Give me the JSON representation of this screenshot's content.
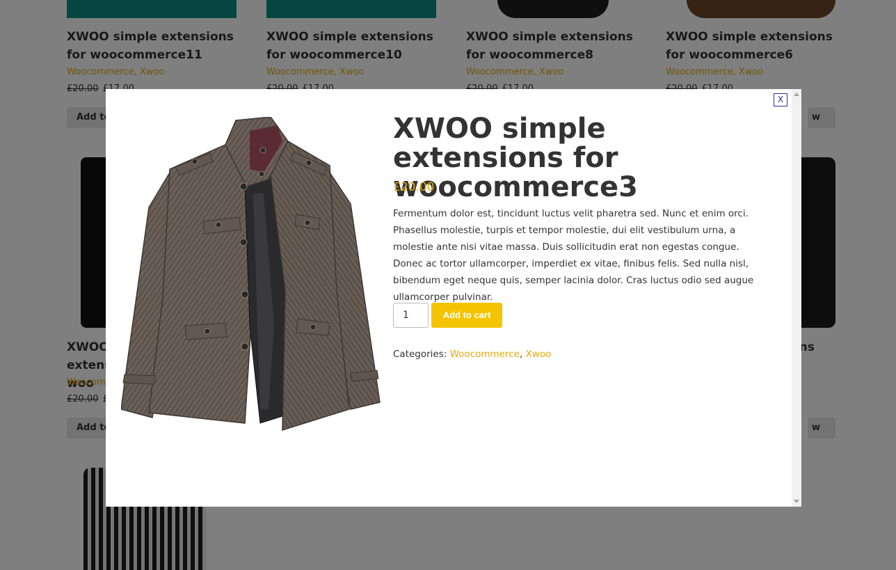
{
  "grid": {
    "cards": [
      {
        "title": "XWOO simple extensions for woocommerce11",
        "categories": "Woocommerce, Xwoo",
        "old_price": "£20.00",
        "price": "£17.00",
        "button": "Add to cart"
      },
      {
        "title": "XWOO simple extensions for woocommerce10",
        "categories": "Woocommerce, Xwoo",
        "old_price": "£20.00",
        "price": "£17.00",
        "button": ""
      },
      {
        "title": "XWOO simple extensions for woocommerce8",
        "categories": "Woocommerce, Xwoo",
        "old_price": "£20.00",
        "price": "£17.00",
        "button": ""
      },
      {
        "title": "XWOO simple extensions for woocommerce6",
        "categories": "Woocommerce, Xwoo",
        "old_price": "£20.00",
        "price": "£17.00",
        "button": "w"
      },
      {
        "title": "XWOO simple extensions for woo",
        "categories": "Woocommerce",
        "old_price": "£20.00",
        "price": "£",
        "button": "Add to"
      },
      {
        "title": "ons",
        "button": "w"
      }
    ]
  },
  "modal": {
    "close_label": "X",
    "title": "XWOO simple extensions for woocommerce3",
    "price": "£20.00",
    "description": "Fermentum dolor est, tincidunt luctus velit pharetra sed. Nunc et enim orci. Phasellus molestie, turpis et tempor molestie, dui elit vestibulum urna, a molestie ante nisi vitae massa. Duis sollicitudin erat non egestas congue. Donec ac tortor ullamcorper, imperdiet ex vitae, finibus felis. Sed nulla nisl, bibendum eget neque quis, semper lacinia dolor. Cras luctus odio sed augue ullamcorper pulvinar.",
    "quantity": "1",
    "add_to_cart_label": "Add to cart",
    "categories_label": "Categories:",
    "categories": [
      "Woocommerce",
      "Xwoo"
    ],
    "categories_separator": ","
  },
  "colors": {
    "accent": "#e6a90f",
    "button": "#f5c400",
    "overlay": "rgba(0,0,0,0.5)",
    "text": "#333333"
  }
}
